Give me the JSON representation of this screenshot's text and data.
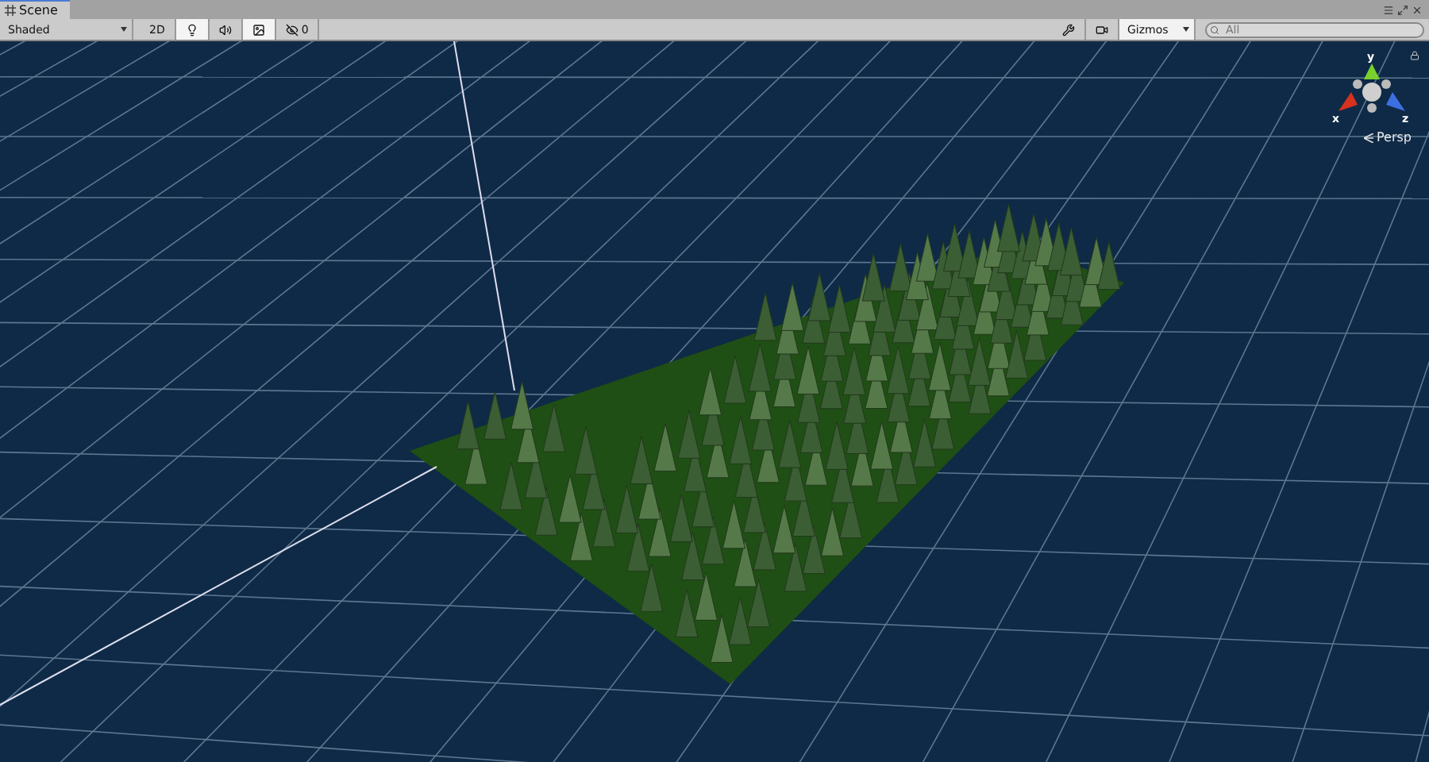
{
  "window": {
    "tab": "Scene"
  },
  "toolbar": {
    "shading": "Shaded",
    "toggles": [
      {
        "kind": "text",
        "label": "2D",
        "selected": false
      },
      {
        "kind": "lighting",
        "selected": true
      },
      {
        "kind": "audio",
        "selected": false
      },
      {
        "kind": "effects",
        "selected": true
      }
    ],
    "hidden_count": "0",
    "gizmos": "Gizmos",
    "search": {
      "placeholder": "All"
    }
  },
  "gizmo": {
    "axes": [
      "y",
      "x",
      "z"
    ],
    "projection": "Persp"
  }
}
